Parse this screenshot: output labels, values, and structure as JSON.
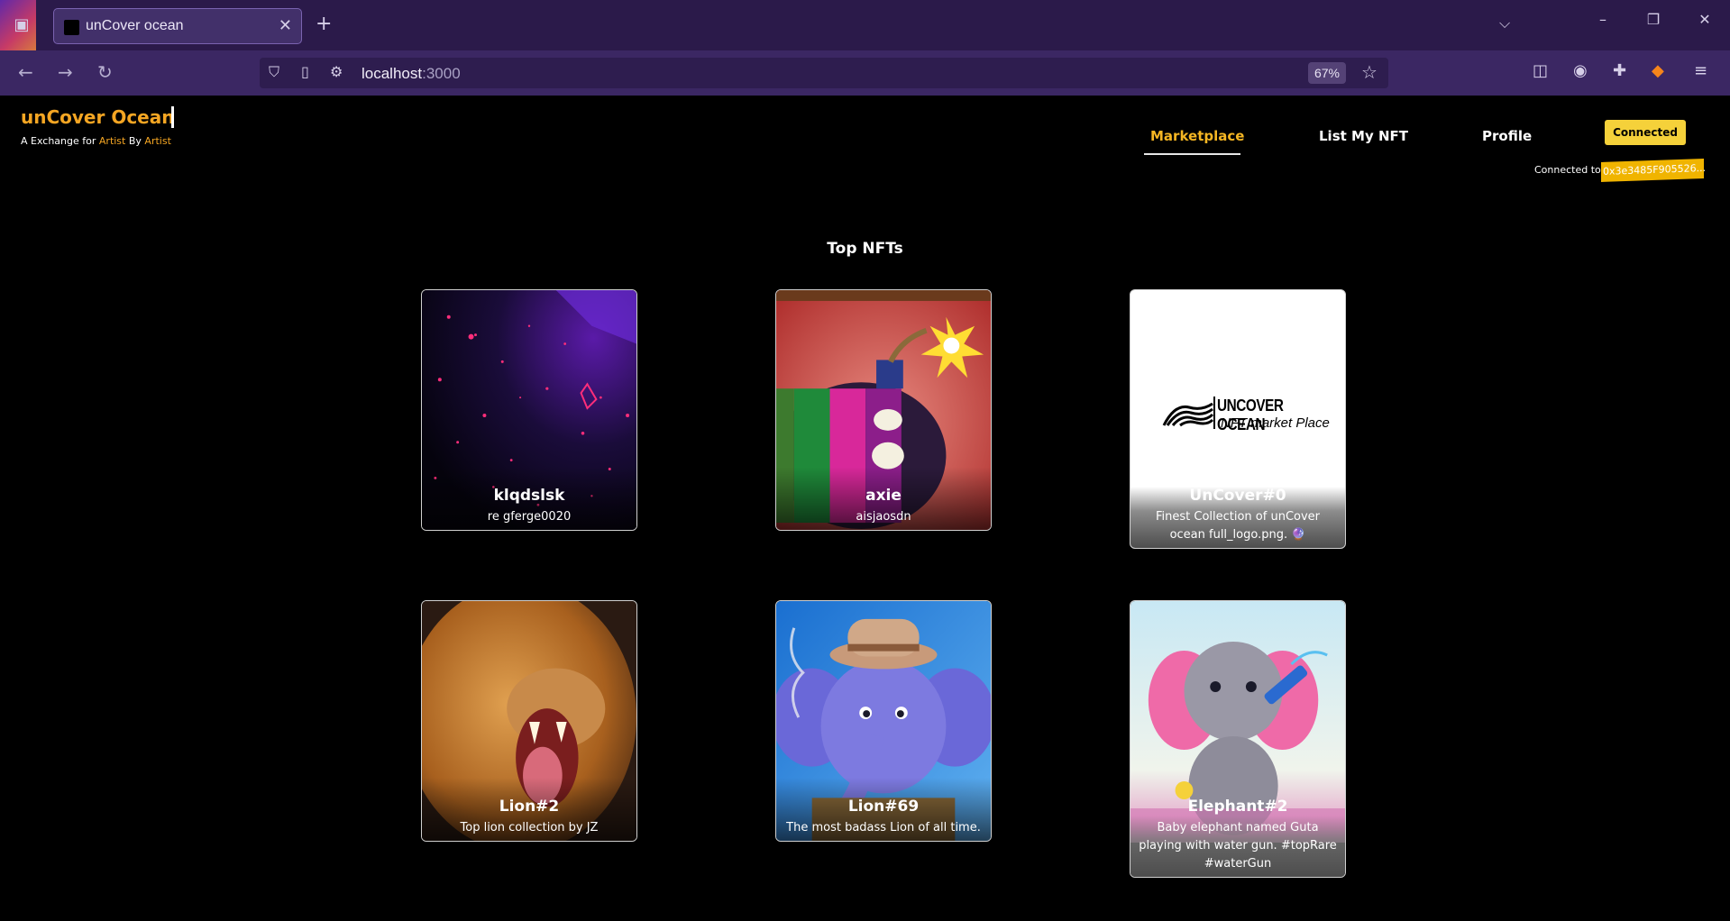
{
  "browser": {
    "tab_title": "unCover ocean",
    "url_host": "localhost",
    "url_port": ":3000",
    "zoom": "67%",
    "icons": [
      "tab-list-icon",
      "close-tab-icon",
      "new-tab-icon",
      "back-icon",
      "forward-icon",
      "reload-icon",
      "shield-icon",
      "page-icon",
      "permissions-icon",
      "bookmark-star-icon",
      "pocket-icon",
      "account-icon",
      "extensions-icon",
      "metamask-icon",
      "menu-icon",
      "list-all-tabs-icon",
      "minimize-icon",
      "restore-icon",
      "close-window-icon"
    ]
  },
  "site": {
    "brand": "unCover Ocean",
    "tagline_prefix": "A Exchange for ",
    "tagline_artist1": "Artist",
    "tagline_by": " By ",
    "tagline_artist2": "Artist",
    "nav": {
      "marketplace": "Marketplace",
      "list_nft": "List My NFT",
      "profile": "Profile"
    },
    "connect_button": "Connected",
    "connected_to_label": "Connected to",
    "address": "0x3e3485F905526..."
  },
  "section_title": "Top NFTs",
  "logo_card_text": {
    "line1": "UNCOVER OCEAN",
    "line2": "NFT market Place"
  },
  "nfts": [
    {
      "name": "klqdslsk",
      "description": "re gferge0020"
    },
    {
      "name": "axie",
      "description": "aisjaosdn"
    },
    {
      "name": "UnCover#0",
      "description": "Finest Collection of unCover ocean full_logo.png. 🔮"
    },
    {
      "name": "Lion#2",
      "description": "Top lion collection by JZ"
    },
    {
      "name": "Lion#69",
      "description": "The most badass Lion of all time."
    },
    {
      "name": "Elephant#2",
      "description": "Baby elephant named Guta playing with water gun. #topRare #waterGun"
    }
  ],
  "colors": {
    "accent": "#f5a623",
    "connect_bg": "#f5d13a",
    "address_bg": "#f0b400"
  }
}
